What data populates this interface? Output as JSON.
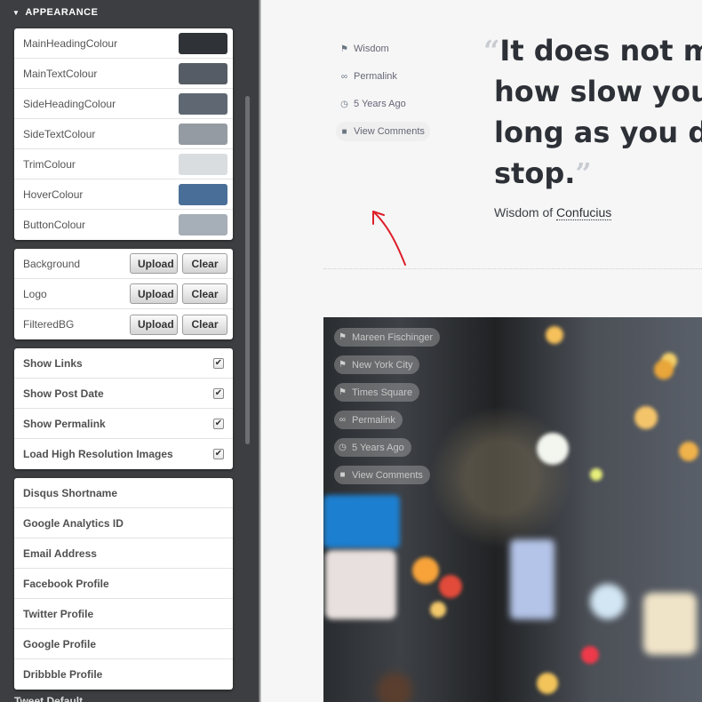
{
  "sidebar": {
    "section_title": "APPEARANCE",
    "colours": [
      {
        "label": "MainHeadingColour",
        "color": "#2f3338"
      },
      {
        "label": "MainTextColour",
        "color": "#555c65"
      },
      {
        "label": "SideHeadingColour",
        "color": "#5f6872"
      },
      {
        "label": "SideTextColour",
        "color": "#959ba2"
      },
      {
        "label": "TrimColour",
        "color": "#d9dde0"
      },
      {
        "label": "HoverColour",
        "color": "#496f98"
      },
      {
        "label": "ButtonColour",
        "color": "#a6aeb7"
      }
    ],
    "uploads": [
      {
        "label": "Background",
        "upload": "Upload",
        "clear": "Clear"
      },
      {
        "label": "Logo",
        "upload": "Upload",
        "clear": "Clear"
      },
      {
        "label": "FilteredBG",
        "upload": "Upload",
        "clear": "Clear"
      }
    ],
    "toggles": [
      {
        "label": "Show Links",
        "checked": true
      },
      {
        "label": "Show Post Date",
        "checked": true
      },
      {
        "label": "Show Permalink",
        "checked": true
      },
      {
        "label": "Load High Resolution Images",
        "checked": true
      }
    ],
    "profiles": [
      {
        "label": "Disqus Shortname"
      },
      {
        "label": "Google Analytics ID"
      },
      {
        "label": "Email Address"
      },
      {
        "label": "Facebook Profile"
      },
      {
        "label": "Twitter Profile"
      },
      {
        "label": "Google Profile"
      },
      {
        "label": "Dribbble Profile"
      }
    ],
    "cut_off_label": "Tweet Default"
  },
  "post1": {
    "meta": [
      {
        "icon": "tag-icon",
        "text": "Wisdom"
      },
      {
        "icon": "link-icon",
        "text": "Permalink"
      },
      {
        "icon": "clock-icon",
        "text": "5 Years Ago"
      },
      {
        "icon": "comment-icon",
        "text": "View Comments"
      }
    ],
    "quote_lines": [
      "It does not m",
      "how slow you",
      "long as you d",
      "stop."
    ],
    "open_mark": "“",
    "close_mark": "”",
    "attribution_prefix": "Wisdom of",
    "attribution_author": "Confucius"
  },
  "post2": {
    "tags": [
      {
        "icon": "tag-icon",
        "text": "Mareen Fischinger"
      },
      {
        "icon": "tag-icon",
        "text": "New York City"
      },
      {
        "icon": "tag-icon",
        "text": "Times Square"
      },
      {
        "icon": "link-icon",
        "text": "Permalink"
      },
      {
        "icon": "clock-icon",
        "text": "5 Years Ago"
      },
      {
        "icon": "comment-icon",
        "text": "View Comments"
      }
    ]
  },
  "colors": {
    "arrow": "#dd1f2a",
    "sidebar_bg": "#3c3e41"
  }
}
